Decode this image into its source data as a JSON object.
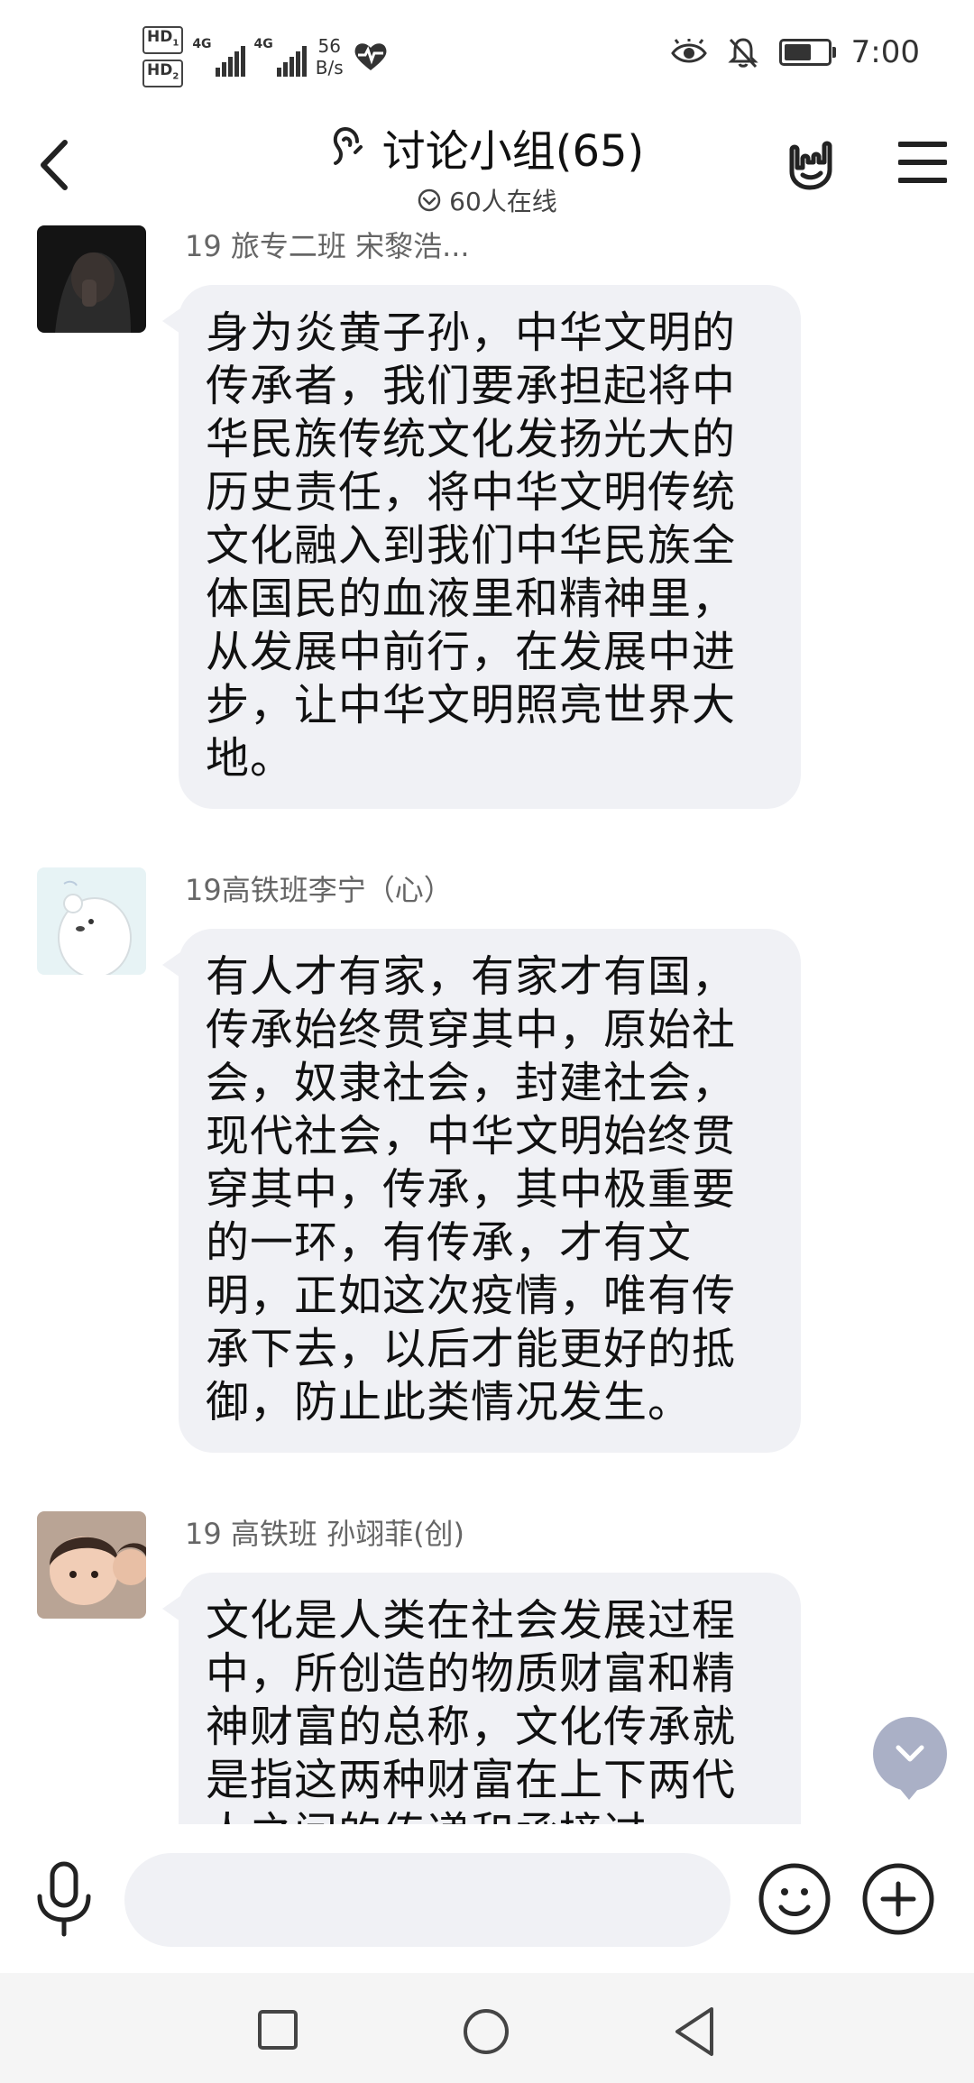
{
  "status_bar": {
    "hd1": "HD",
    "hd1_sub": "1",
    "hd2": "HD",
    "hd2_sub": "2",
    "signal1_label": "4G",
    "signal2_label": "4G",
    "net_speed_value": "56",
    "net_speed_unit": "B/s",
    "time": "7:00",
    "battery_level": 0.75,
    "icons": [
      "heart-pulse-icon",
      "eye-icon",
      "bell-off-icon",
      "battery-icon"
    ]
  },
  "header": {
    "title": "讨论小组(65)",
    "online": "60人在线",
    "icons": [
      "back-arrow-icon",
      "ear-icon",
      "check-circle-icon",
      "hand-gesture-icon",
      "menu-icon"
    ]
  },
  "messages": [
    {
      "sender": "19 旅专二班 宋黎浩...",
      "text": "身为炎黄子孙，中华文明的传承者，我们要承担起将中华民族传统文化发扬光大的历史责任，将中华文明传统文化融入到我们中华民族全体国民的血液里和精神里，从发展中前行，在发展中进步，让中华文明照亮世界大地。"
    },
    {
      "sender": "19高铁班李宁（心）",
      "text": "有人才有家，有家才有国，传承始终贯穿其中，原始社会，奴隶社会，封建社会，现代社会，中华文明始终贯穿其中，传承，其中极重要的一环，有传承，才有文明，正如这次疫情，唯有传承下去，以后才能更好的抵御，防止此类情况发生。"
    },
    {
      "sender": "19 高铁班 孙翊菲(创)",
      "text": "文化是人类在社会发展过程中，所创造的物质财富和精神财富的总称，文化传承就是指这两种财富在上下两代人之间的传递和承接过"
    }
  ],
  "input": {
    "placeholder": ""
  },
  "colors": {
    "bubble": "#f0f1f5",
    "fab": "#aab0c6",
    "nav_bar": "#f5f5f5"
  }
}
